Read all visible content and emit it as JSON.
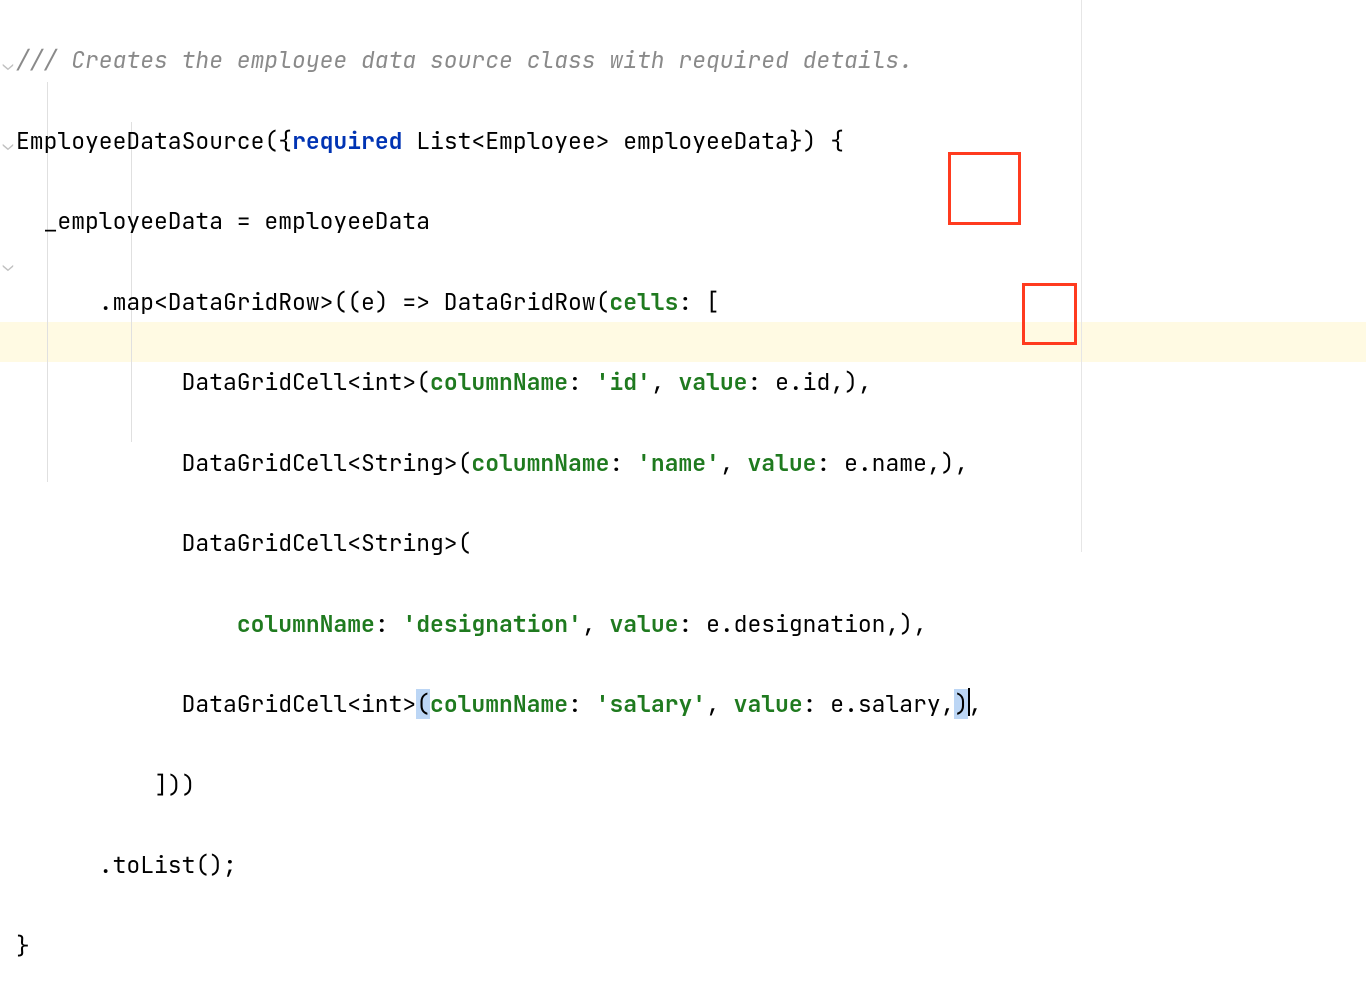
{
  "code": {
    "l1_comment": "/// Creates the employee data source class with required details.",
    "l2_pre": "EmployeeDataSource({",
    "l2_kw": "required",
    "l2_post": " List<Employee> employeeData}) {",
    "l3": "  _employeeData = employeeData",
    "l4_pre": "      .map<DataGridRow>((e) => DataGridRow(",
    "l4_named": "cells",
    "l4_post": ": [",
    "l5_pre": "            DataGridCell<int>(",
    "l5_col": "columnName",
    "l5_col_sep": ": ",
    "l5_col_val": "'id'",
    "l5_sep": ", ",
    "l5_val": "value",
    "l5_val_post": ": e.id,),",
    "l6_pre": "            DataGridCell<String>(",
    "l6_col": "columnName",
    "l6_col_sep": ": ",
    "l6_col_val": "'name'",
    "l6_sep": ", ",
    "l6_val": "value",
    "l6_val_post": ": e.name,),",
    "l7": "            DataGridCell<String>(",
    "l8_pre": "                ",
    "l8_col": "columnName",
    "l8_col_sep": ": ",
    "l8_col_val": "'designation'",
    "l8_sep": ", ",
    "l8_val": "value",
    "l8_val_post": ": e.designation,),",
    "l9_pre": "            DataGridCell<int>",
    "l9_open": "(",
    "l9_col": "columnName",
    "l9_col_sep": ": ",
    "l9_col_val": "'salary'",
    "l9_sep": ", ",
    "l9_val": "value",
    "l9_val_mid": ": e.salary,",
    "l9_close": ")",
    "l9_tail": ",",
    "l10": "          ]))",
    "l11": "      .toList();",
    "l12": "}"
  }
}
